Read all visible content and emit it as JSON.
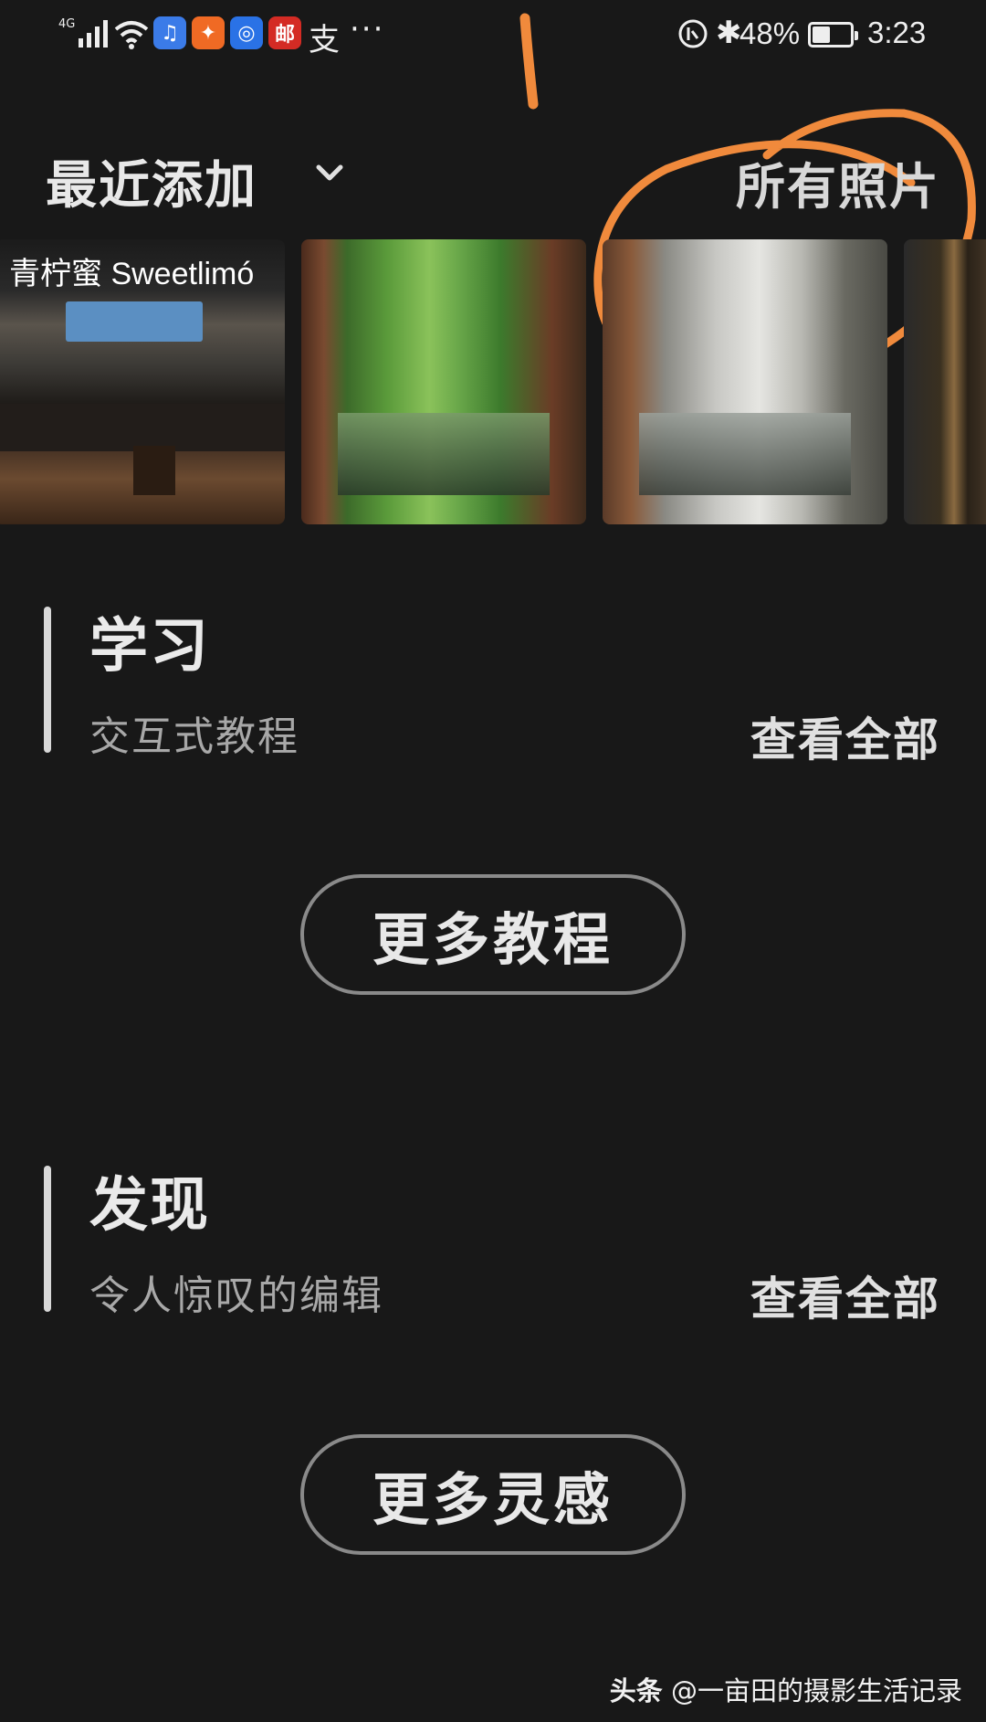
{
  "status_bar": {
    "network": "4G",
    "app_icons": [
      "music-app",
      "people-app",
      "browser-app",
      "post-app"
    ],
    "post_glyph": "邮",
    "extra_glyph": "支",
    "more": "···",
    "battery_percent_text": "48%",
    "battery_level": 0.48,
    "time": "3:23"
  },
  "annotation": {
    "mark_text": "1",
    "color": "#f08a3c"
  },
  "recent": {
    "title": "最近添加",
    "all_photos": "所有照片",
    "thumbnails": [
      {
        "name": "shop-photo",
        "sign": "青柠蜜 Sweetlimó"
      },
      {
        "name": "forest-green-photo"
      },
      {
        "name": "forest-snow-photo"
      },
      {
        "name": "dark-partial-photo"
      }
    ]
  },
  "learn": {
    "title": "学习",
    "subtitle": "交互式教程",
    "view_all": "查看全部",
    "more_button": "更多教程"
  },
  "discover": {
    "title": "发现",
    "subtitle": "令人惊叹的编辑",
    "view_all": "查看全部",
    "more_button": "更多灵感"
  },
  "watermark": {
    "source": "头条",
    "handle": "@一亩田的摄影生活记录"
  },
  "colors": {
    "background": "#181818",
    "annotation_orange": "#f08a3c",
    "pill_border": "#8a8a8a"
  }
}
